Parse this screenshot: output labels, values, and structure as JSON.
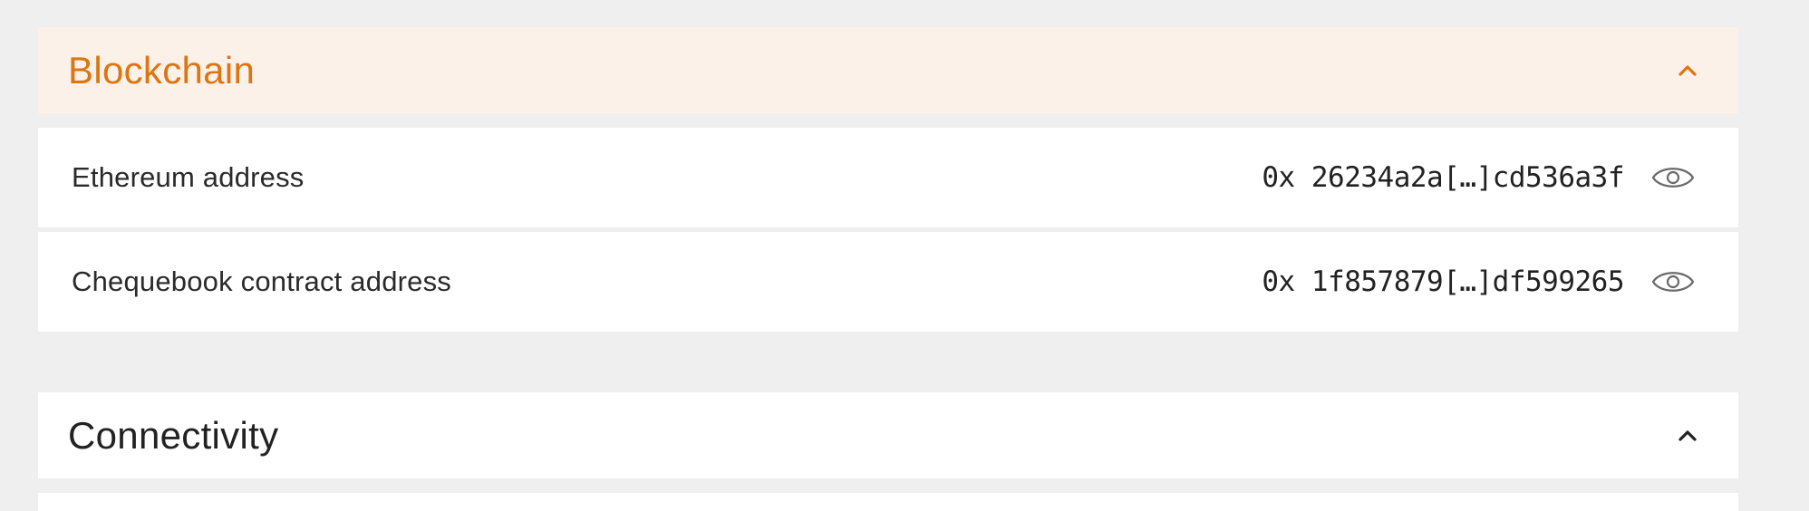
{
  "blockchain": {
    "title": "Blockchain",
    "rows": [
      {
        "label": "Ethereum address",
        "value": "0x 26234a2a[…]cd536a3f",
        "icon": "eye-icon"
      },
      {
        "label": "Chequebook contract address",
        "value": "0x 1f857879[…]df599265",
        "icon": "eye-icon"
      }
    ],
    "accent_color": "#dc7512",
    "header_bg": "#fbf1e8"
  },
  "connectivity": {
    "title": "Connectivity"
  }
}
